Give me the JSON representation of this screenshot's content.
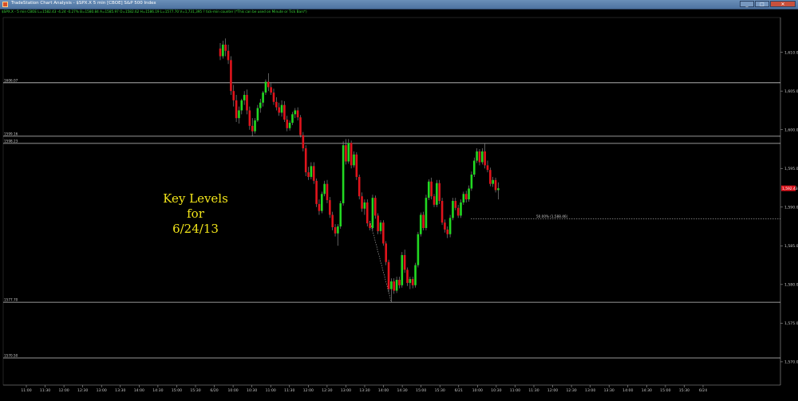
{
  "window": {
    "title": "TradeStation Chart Analysis - $SPX.X 5 min [CBOE] S&P 500 Index",
    "minimize_label": "_",
    "maximize_label": "□",
    "close_label": "✕"
  },
  "status_line": "$SPX.X - 5 min CBOE L=1582.43 -4.24 -0.27% B=1580.84 A=1585.97 O=1582.62 H=1586.19 L=1577.70 V=1,731,395 ? tick-min counter (*This can be used on Minute or Tick Bars*)",
  "overlay": {
    "line1": "Key Levels",
    "line2": "for",
    "line3": "6/24/13"
  },
  "colors": {
    "background": "#000000",
    "up_candle": "#22d822",
    "down_candle": "#e0141c",
    "level_line": "#c8c8c8",
    "price_tag": "#d8141c",
    "overlay_text": "#f2e51a"
  },
  "chart_data": {
    "type": "candlestick",
    "title": "",
    "y_axis_side": "right",
    "ylim": [
      1567.0,
      1614.5
    ],
    "y_ticks": [
      {
        "value": 1610.0,
        "label": "1,610.00"
      },
      {
        "value": 1605.0,
        "label": "1,605.00"
      },
      {
        "value": 1600.0,
        "label": "1,600.00"
      },
      {
        "value": 1595.0,
        "label": "1,595.00"
      },
      {
        "value": 1590.0,
        "label": "1,590.00"
      },
      {
        "value": 1585.0,
        "label": "1,585.00"
      },
      {
        "value": 1580.0,
        "label": "1,580.00"
      },
      {
        "value": 1575.0,
        "label": "1,575.00"
      },
      {
        "value": 1570.0,
        "label": "1,570.00"
      }
    ],
    "x_tick_labels": [
      "11:00",
      "11:30",
      "12:00",
      "12:30",
      "13:00",
      "13:30",
      "14:00",
      "14:30",
      "15:00",
      "15:30",
      "6/20",
      "10:00",
      "10:30",
      "11:00",
      "11:30",
      "12:00",
      "12:30",
      "13:00",
      "13:30",
      "14:00",
      "14:30",
      "15:00",
      "15:30",
      "6/21",
      "10:00",
      "10:30",
      "11:00",
      "11:30",
      "12:00",
      "12:30",
      "13:00",
      "13:30",
      "14:00",
      "14:30",
      "15:00",
      "15:30",
      "6/24"
    ],
    "key_levels": [
      {
        "value": 1606.07,
        "label": "1606.07"
      },
      {
        "value": 1599.16,
        "label": "1599.16"
      },
      {
        "value": 1598.23,
        "label": "1598.23"
      },
      {
        "value": 1577.7,
        "label": "1577.70"
      },
      {
        "value": 1570.5,
        "label": "1570.50"
      }
    ],
    "last_price": {
      "value": 1592.43,
      "label": "1,592.43"
    },
    "fib_annotation": {
      "label": "50.00% (1,588.46)",
      "value": 1588.46
    },
    "candles": [
      [
        1610.5,
        1611.2,
        1609.0,
        1609.5
      ],
      [
        1609.5,
        1611.5,
        1609.2,
        1611.0
      ],
      [
        1611.0,
        1611.8,
        1609.5,
        1610.2
      ],
      [
        1610.2,
        1611.0,
        1608.5,
        1609.0
      ],
      [
        1609.0,
        1609.5,
        1604.5,
        1605.0
      ],
      [
        1605.0,
        1605.8,
        1603.0,
        1603.8
      ],
      [
        1603.8,
        1604.5,
        1601.0,
        1601.5
      ],
      [
        1601.5,
        1603.0,
        1600.8,
        1602.5
      ],
      [
        1602.5,
        1604.0,
        1602.0,
        1603.8
      ],
      [
        1603.8,
        1605.0,
        1603.2,
        1604.5
      ],
      [
        1604.5,
        1605.2,
        1602.0,
        1602.5
      ],
      [
        1602.5,
        1603.0,
        1600.0,
        1600.5
      ],
      [
        1600.5,
        1601.5,
        1599.2,
        1599.8
      ],
      [
        1599.8,
        1601.5,
        1599.5,
        1601.2
      ],
      [
        1601.2,
        1603.2,
        1601.0,
        1602.8
      ],
      [
        1602.8,
        1604.0,
        1602.2,
        1603.5
      ],
      [
        1603.5,
        1605.0,
        1603.0,
        1604.8
      ],
      [
        1604.8,
        1606.5,
        1604.5,
        1606.2
      ],
      [
        1606.2,
        1607.3,
        1605.0,
        1605.5
      ],
      [
        1605.5,
        1606.0,
        1604.5,
        1604.8
      ],
      [
        1604.8,
        1605.3,
        1603.2,
        1603.6
      ],
      [
        1603.6,
        1604.2,
        1602.5,
        1602.9
      ],
      [
        1602.9,
        1603.5,
        1601.8,
        1602.2
      ],
      [
        1602.2,
        1603.8,
        1601.7,
        1603.2
      ],
      [
        1603.2,
        1603.7,
        1601.0,
        1601.3
      ],
      [
        1601.3,
        1601.8,
        1599.8,
        1600.2
      ],
      [
        1600.2,
        1601.2,
        1599.9,
        1600.9
      ],
      [
        1600.9,
        1602.3,
        1600.6,
        1602.0
      ],
      [
        1602.0,
        1602.8,
        1601.5,
        1602.5
      ],
      [
        1602.5,
        1602.9,
        1601.2,
        1601.6
      ],
      [
        1601.6,
        1601.9,
        1599.0,
        1599.3
      ],
      [
        1599.3,
        1599.7,
        1597.2,
        1597.6
      ],
      [
        1597.6,
        1598.0,
        1594.0,
        1594.5
      ],
      [
        1594.5,
        1595.2,
        1593.5,
        1593.9
      ],
      [
        1593.9,
        1595.8,
        1593.6,
        1595.3
      ],
      [
        1595.3,
        1595.8,
        1593.0,
        1593.4
      ],
      [
        1593.4,
        1593.7,
        1590.0,
        1590.4
      ],
      [
        1590.4,
        1591.0,
        1589.0,
        1589.5
      ],
      [
        1589.5,
        1592.0,
        1589.2,
        1591.7
      ],
      [
        1591.7,
        1593.4,
        1591.4,
        1593.0
      ],
      [
        1593.0,
        1593.5,
        1590.5,
        1590.9
      ],
      [
        1590.9,
        1591.3,
        1588.6,
        1589.0
      ],
      [
        1589.0,
        1589.4,
        1587.0,
        1587.4
      ],
      [
        1587.4,
        1587.8,
        1586.2,
        1586.6
      ],
      [
        1586.6,
        1587.8,
        1585.0,
        1587.5
      ],
      [
        1587.5,
        1590.8,
        1587.2,
        1590.5
      ],
      [
        1590.5,
        1598.5,
        1590.2,
        1598.0
      ],
      [
        1598.0,
        1598.8,
        1595.5,
        1595.9
      ],
      [
        1595.9,
        1598.8,
        1595.6,
        1598.3
      ],
      [
        1598.3,
        1598.6,
        1595.0,
        1595.4
      ],
      [
        1595.4,
        1597.2,
        1595.1,
        1596.8
      ],
      [
        1596.8,
        1597.1,
        1593.5,
        1593.9
      ],
      [
        1593.9,
        1594.2,
        1591.0,
        1591.4
      ],
      [
        1591.4,
        1591.9,
        1589.4,
        1589.8
      ],
      [
        1589.8,
        1591.0,
        1589.0,
        1590.6
      ],
      [
        1590.6,
        1591.0,
        1587.5,
        1587.9
      ],
      [
        1587.9,
        1588.2,
        1587.0,
        1587.3
      ],
      [
        1587.3,
        1591.6,
        1587.0,
        1591.2
      ],
      [
        1591.2,
        1591.5,
        1588.5,
        1588.9
      ],
      [
        1588.9,
        1589.2,
        1586.5,
        1586.9
      ],
      [
        1586.9,
        1588.3,
        1586.5,
        1588.0
      ],
      [
        1588.0,
        1588.3,
        1585.0,
        1585.3
      ],
      [
        1585.3,
        1585.6,
        1582.5,
        1582.9
      ],
      [
        1582.9,
        1583.2,
        1579.0,
        1579.4
      ],
      [
        1579.4,
        1580.8,
        1577.7,
        1580.4
      ],
      [
        1580.4,
        1580.8,
        1578.8,
        1579.2
      ],
      [
        1579.2,
        1581.0,
        1578.9,
        1580.6
      ],
      [
        1580.6,
        1581.0,
        1579.5,
        1579.9
      ],
      [
        1579.9,
        1584.2,
        1579.6,
        1583.8
      ],
      [
        1583.8,
        1584.5,
        1581.5,
        1581.9
      ],
      [
        1581.9,
        1582.2,
        1579.8,
        1580.2
      ],
      [
        1580.2,
        1581.0,
        1579.4,
        1580.7
      ],
      [
        1580.7,
        1581.0,
        1579.5,
        1579.9
      ],
      [
        1579.9,
        1582.8,
        1579.6,
        1582.5
      ],
      [
        1582.5,
        1586.8,
        1582.2,
        1586.5
      ],
      [
        1586.5,
        1589.3,
        1586.2,
        1589.0
      ],
      [
        1589.0,
        1589.4,
        1587.0,
        1587.3
      ],
      [
        1587.3,
        1591.6,
        1587.0,
        1591.2
      ],
      [
        1591.2,
        1593.6,
        1590.9,
        1593.3
      ],
      [
        1593.3,
        1593.8,
        1591.0,
        1591.4
      ],
      [
        1591.4,
        1591.7,
        1590.0,
        1590.3
      ],
      [
        1590.3,
        1593.5,
        1590.0,
        1593.1
      ],
      [
        1593.1,
        1593.5,
        1590.4,
        1590.8
      ],
      [
        1590.8,
        1591.2,
        1587.7,
        1588.0
      ],
      [
        1588.0,
        1588.4,
        1586.7,
        1587.1
      ],
      [
        1587.1,
        1587.5,
        1586.0,
        1586.5
      ],
      [
        1586.5,
        1589.0,
        1586.1,
        1588.6
      ],
      [
        1588.6,
        1591.2,
        1588.3,
        1590.8
      ],
      [
        1590.8,
        1591.2,
        1589.6,
        1589.9
      ],
      [
        1589.9,
        1590.3,
        1588.6,
        1588.9
      ],
      [
        1588.9,
        1591.0,
        1588.6,
        1590.6
      ],
      [
        1590.6,
        1592.0,
        1590.3,
        1591.7
      ],
      [
        1591.7,
        1592.1,
        1590.6,
        1591.0
      ],
      [
        1591.0,
        1592.8,
        1590.7,
        1592.4
      ],
      [
        1592.4,
        1594.6,
        1592.1,
        1594.2
      ],
      [
        1594.2,
        1596.4,
        1593.9,
        1596.0
      ],
      [
        1596.0,
        1597.6,
        1595.7,
        1597.2
      ],
      [
        1597.2,
        1597.5,
        1595.4,
        1595.8
      ],
      [
        1595.8,
        1597.6,
        1595.5,
        1597.2
      ],
      [
        1597.2,
        1598.2,
        1595.0,
        1595.4
      ],
      [
        1595.4,
        1596.0,
        1594.5,
        1594.8
      ],
      [
        1594.8,
        1595.1,
        1592.7,
        1593.0
      ],
      [
        1593.0,
        1593.9,
        1592.6,
        1593.5
      ],
      [
        1593.5,
        1593.8,
        1591.9,
        1592.2
      ],
      [
        1592.2,
        1593.2,
        1591.0,
        1592.43
      ]
    ],
    "x_spacing_px": 3.35
  }
}
